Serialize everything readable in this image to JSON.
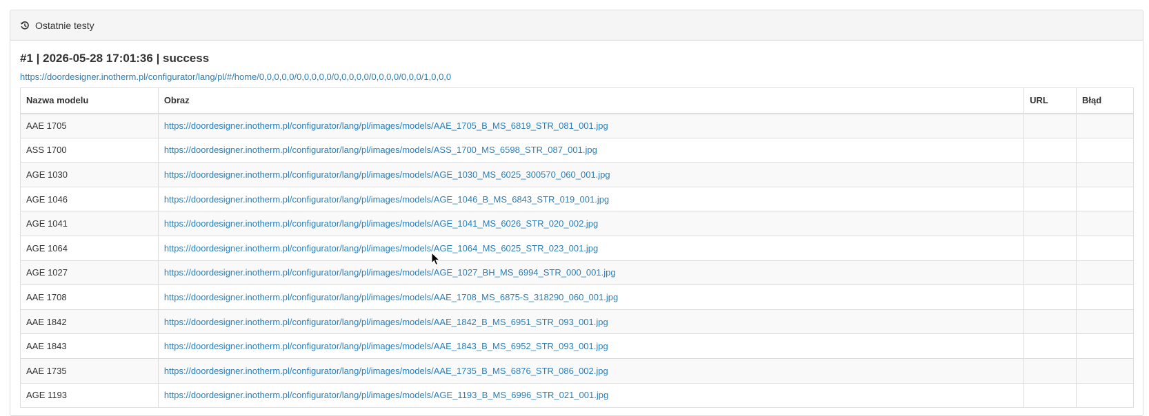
{
  "panel": {
    "heading": "Ostatnie testy",
    "heading_icon": "history-icon"
  },
  "test": {
    "title": "#1 | 2026-05-28 17:01:36 | success",
    "url": "https://doordesigner.inotherm.pl/configurator/lang/pl/#/home/0,0,0,0,0/0,0,0,0,0/0,0,0,0,0/0,0,0,0/0,0,0/1,0,0,0"
  },
  "table": {
    "headers": {
      "name": "Nazwa modelu",
      "image": "Obraz",
      "url": "URL",
      "error": "Błąd"
    },
    "rows": [
      {
        "name": "AAE 1705",
        "image": "https://doordesigner.inotherm.pl/configurator/lang/pl/images/models/AAE_1705_B_MS_6819_STR_081_001.jpg",
        "url": "",
        "error": ""
      },
      {
        "name": "ASS 1700",
        "image": "https://doordesigner.inotherm.pl/configurator/lang/pl/images/models/ASS_1700_MS_6598_STR_087_001.jpg",
        "url": "",
        "error": ""
      },
      {
        "name": "AGE 1030",
        "image": "https://doordesigner.inotherm.pl/configurator/lang/pl/images/models/AGE_1030_MS_6025_300570_060_001.jpg",
        "url": "",
        "error": ""
      },
      {
        "name": "AGE 1046",
        "image": "https://doordesigner.inotherm.pl/configurator/lang/pl/images/models/AGE_1046_B_MS_6843_STR_019_001.jpg",
        "url": "",
        "error": ""
      },
      {
        "name": "AGE 1041",
        "image": "https://doordesigner.inotherm.pl/configurator/lang/pl/images/models/AGE_1041_MS_6026_STR_020_002.jpg",
        "url": "",
        "error": ""
      },
      {
        "name": "AGE 1064",
        "image": "https://doordesigner.inotherm.pl/configurator/lang/pl/images/models/AGE_1064_MS_6025_STR_023_001.jpg",
        "url": "",
        "error": ""
      },
      {
        "name": "AGE 1027",
        "image": "https://doordesigner.inotherm.pl/configurator/lang/pl/images/models/AGE_1027_BH_MS_6994_STR_000_001.jpg",
        "url": "",
        "error": ""
      },
      {
        "name": "AAE 1708",
        "image": "https://doordesigner.inotherm.pl/configurator/lang/pl/images/models/AAE_1708_MS_6875-S_318290_060_001.jpg",
        "url": "",
        "error": ""
      },
      {
        "name": "AAE 1842",
        "image": "https://doordesigner.inotherm.pl/configurator/lang/pl/images/models/AAE_1842_B_MS_6951_STR_093_001.jpg",
        "url": "",
        "error": ""
      },
      {
        "name": "AAE 1843",
        "image": "https://doordesigner.inotherm.pl/configurator/lang/pl/images/models/AAE_1843_B_MS_6952_STR_093_001.jpg",
        "url": "",
        "error": ""
      },
      {
        "name": "AAE 1735",
        "image": "https://doordesigner.inotherm.pl/configurator/lang/pl/images/models/AAE_1735_B_MS_6876_STR_086_002.jpg",
        "url": "",
        "error": ""
      },
      {
        "name": "AGE 1193",
        "image": "https://doordesigner.inotherm.pl/configurator/lang/pl/images/models/AGE_1193_B_MS_6996_STR_021_001.jpg",
        "url": "",
        "error": ""
      }
    ]
  },
  "colors": {
    "link": "#2a7fb8",
    "heading_bg": "#f5f5f5",
    "border": "#dddddd",
    "stripe": "#f9f9f9"
  }
}
